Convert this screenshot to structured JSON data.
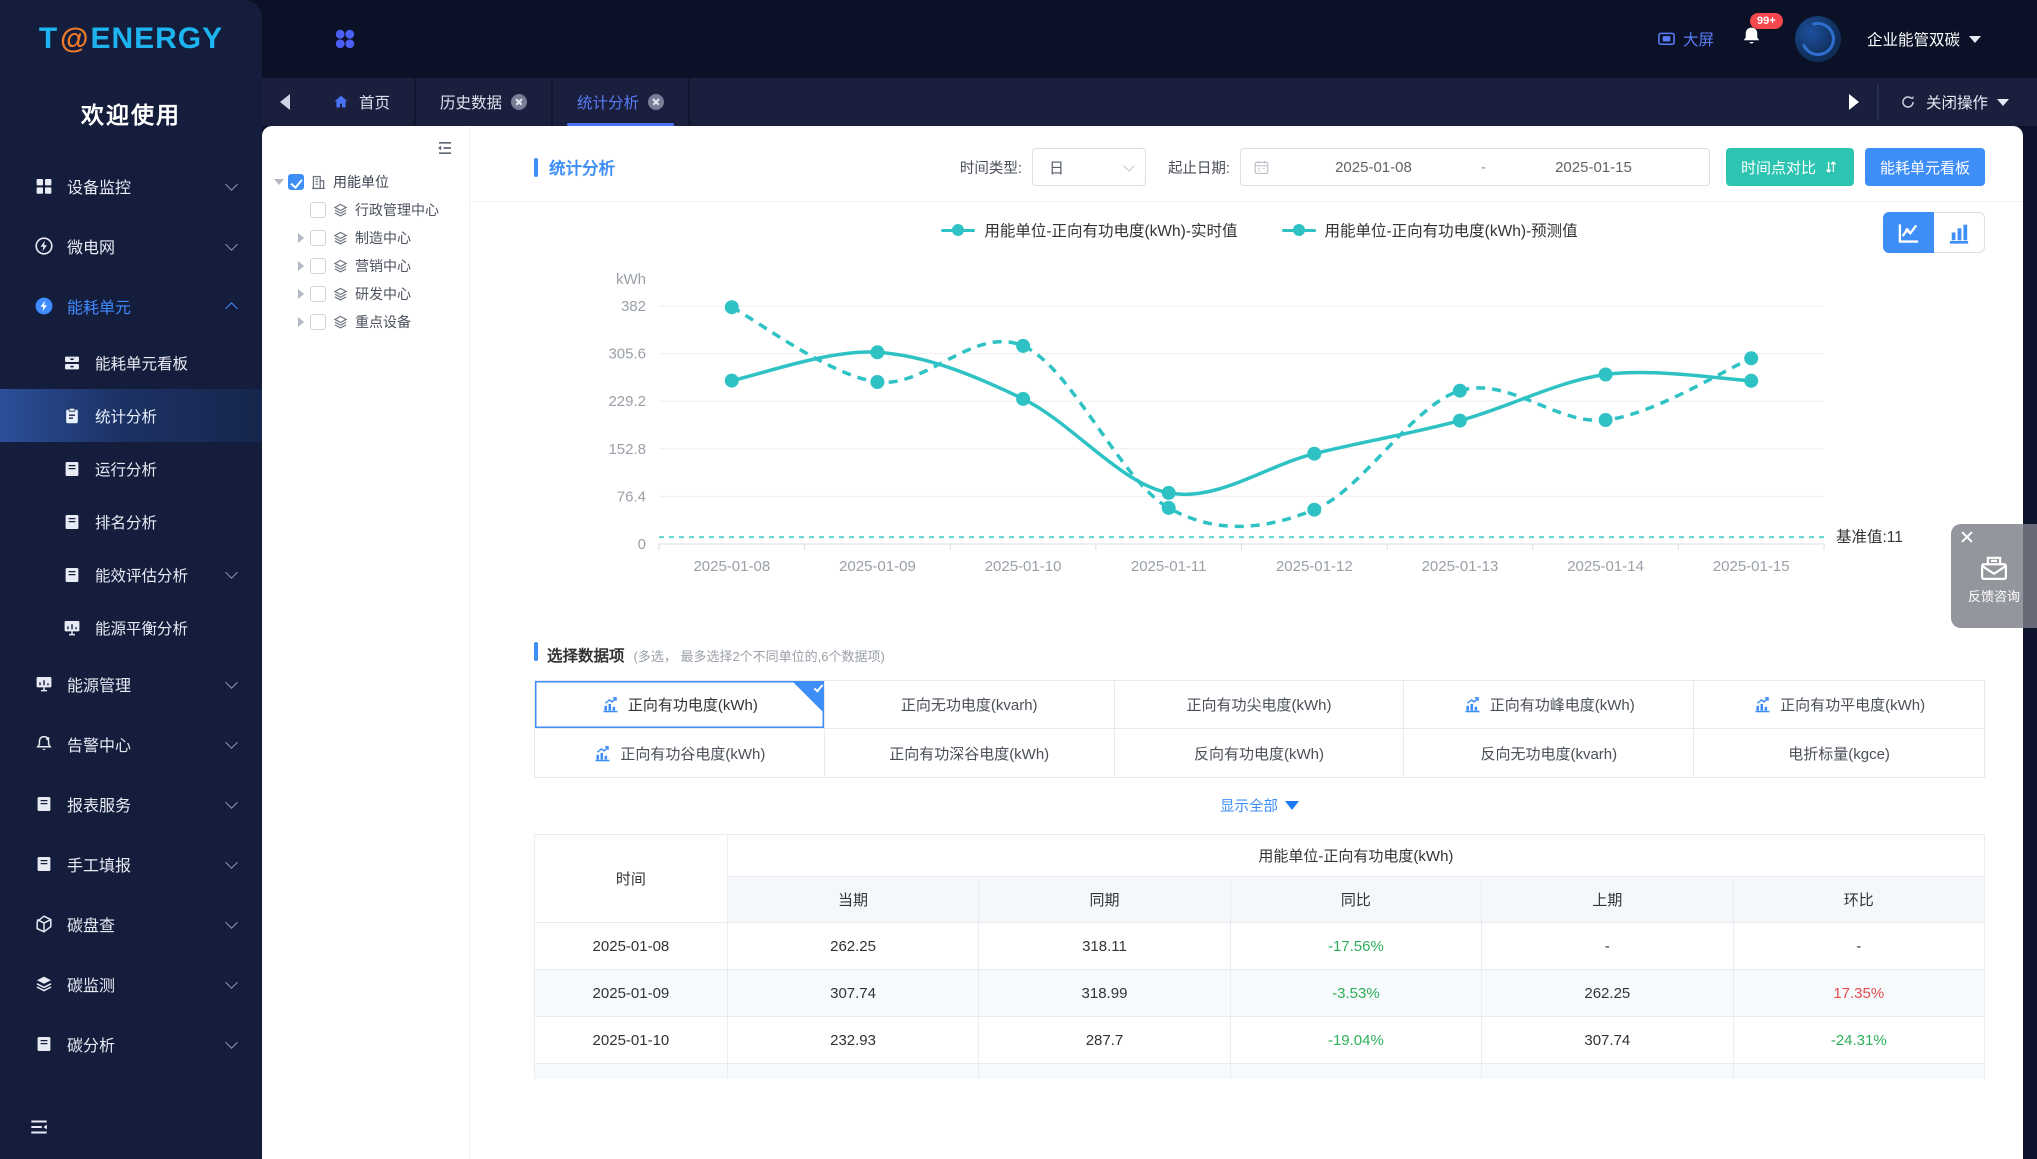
{
  "brand": {
    "logo_t": "T",
    "logo_at": "@",
    "logo_rest": "ENERGY",
    "welcome": "欢迎使用"
  },
  "header": {
    "apps_icon": "apps-grid-icon",
    "big_screen": "大屏",
    "notification_badge": "99+",
    "org_name": "企业能管双碳"
  },
  "tabbar": {
    "home_label": "首页",
    "tabs": [
      {
        "label": "历史数据",
        "active": false
      },
      {
        "label": "统计分析",
        "active": true
      }
    ],
    "close_ops_label": "关闭操作"
  },
  "sidebar": {
    "items": [
      {
        "label": "设备监控",
        "icon": "devices-icon",
        "level": 1,
        "chevron": "down"
      },
      {
        "label": "微电网",
        "icon": "microgrid-icon",
        "level": 1,
        "chevron": "down"
      },
      {
        "label": "能耗单元",
        "icon": "energy-unit-icon",
        "level": 1,
        "chevron": "up",
        "parent_active": true
      },
      {
        "label": "能耗单元看板",
        "icon": "board-icon",
        "level": 2
      },
      {
        "label": "统计分析",
        "icon": "clipboard-icon",
        "level": 2,
        "active": true
      },
      {
        "label": "运行分析",
        "icon": "book-icon",
        "level": 2
      },
      {
        "label": "排名分析",
        "icon": "book-icon",
        "level": 2
      },
      {
        "label": "能效评估分析",
        "icon": "book-icon",
        "level": 2,
        "chevron": "down"
      },
      {
        "label": "能源平衡分析",
        "icon": "monitor-bars-icon",
        "level": 2
      },
      {
        "label": "能源管理",
        "icon": "monitor-bars-icon",
        "level": 1,
        "chevron": "down"
      },
      {
        "label": "告警中心",
        "icon": "alarm-bell-icon",
        "level": 1,
        "chevron": "down"
      },
      {
        "label": "报表服务",
        "icon": "book-icon",
        "level": 1,
        "chevron": "down"
      },
      {
        "label": "手工填报",
        "icon": "book-icon",
        "level": 1,
        "chevron": "down"
      },
      {
        "label": "碳盘查",
        "icon": "cube-icon",
        "level": 1,
        "chevron": "down"
      },
      {
        "label": "碳监测",
        "icon": "layers-icon",
        "level": 1,
        "chevron": "down"
      },
      {
        "label": "碳分析",
        "icon": "book-icon",
        "level": 1,
        "chevron": "down"
      }
    ]
  },
  "tree": {
    "root": {
      "label": "用能单位",
      "checked": true,
      "icon": "building-icon"
    },
    "children": [
      {
        "label": "行政管理中心",
        "caret": false
      },
      {
        "label": "制造中心",
        "caret": true
      },
      {
        "label": "营销中心",
        "caret": true
      },
      {
        "label": "研发中心",
        "caret": true
      },
      {
        "label": "重点设备",
        "caret": true
      }
    ]
  },
  "toolbar": {
    "title": "统计分析",
    "time_type_label": "时间类型:",
    "time_type_value": "日",
    "date_label": "起止日期:",
    "date_start": "2025-01-08",
    "date_separator": "-",
    "date_end": "2025-01-15",
    "compare_button": "时间点对比",
    "board_button": "能耗单元看板"
  },
  "chart_data": {
    "type": "line",
    "title": "",
    "ylabel": "kWh",
    "yticks": [
      0,
      76.4,
      152.8,
      229.2,
      305.6,
      382
    ],
    "ylim": [
      0,
      382
    ],
    "grid": true,
    "legend_position": "top",
    "x": [
      "2025-01-08",
      "2025-01-09",
      "2025-01-10",
      "2025-01-11",
      "2025-01-12",
      "2025-01-13",
      "2025-01-14",
      "2025-01-15"
    ],
    "series": [
      {
        "name": "用能单位-正向有功电度(kWh)-实时值",
        "style": "solid",
        "values": [
          262.25,
          307.74,
          232.93,
          82,
          145,
          198,
          272,
          262
        ]
      },
      {
        "name": "用能单位-正向有功电度(kWh)-预测值",
        "style": "dashed",
        "values": [
          380,
          260,
          318,
          58,
          55,
          246,
          199,
          298
        ]
      }
    ],
    "baseline": {
      "value": 11,
      "label": "基准值:11"
    },
    "line_color": "#2fc2c4"
  },
  "data_items": {
    "title": "选择数据项",
    "hint": "(多选， 最多选择2个不同单位的,6个数据项)",
    "show_all": "显示全部",
    "items": [
      {
        "label": "正向有功电度(kWh)",
        "selected": true,
        "icon": true
      },
      {
        "label": "正向无功电度(kvarh)",
        "selected": false,
        "icon": false
      },
      {
        "label": "正向有功尖电度(kWh)",
        "selected": false,
        "icon": false
      },
      {
        "label": "正向有功峰电度(kWh)",
        "selected": false,
        "icon": true
      },
      {
        "label": "正向有功平电度(kWh)",
        "selected": false,
        "icon": true
      },
      {
        "label": "正向有功谷电度(kWh)",
        "selected": false,
        "icon": true
      },
      {
        "label": "正向有功深谷电度(kWh)",
        "selected": false,
        "icon": false
      },
      {
        "label": "反向有功电度(kWh)",
        "selected": false,
        "icon": false
      },
      {
        "label": "反向无功电度(kvarh)",
        "selected": false,
        "icon": false
      },
      {
        "label": "电折标量(kgce)",
        "selected": false,
        "icon": false
      }
    ]
  },
  "table": {
    "time_header": "时间",
    "group_header": "用能单位-正向有功电度(kWh)",
    "sub_headers": [
      "当期",
      "同期",
      "同比",
      "上期",
      "环比"
    ],
    "rows": [
      {
        "time": "2025-01-08",
        "cells": [
          {
            "v": "262.25",
            "c": ""
          },
          {
            "v": "318.11",
            "c": ""
          },
          {
            "v": "-17.56%",
            "c": "green"
          },
          {
            "v": "-",
            "c": ""
          },
          {
            "v": "-",
            "c": ""
          }
        ]
      },
      {
        "time": "2025-01-09",
        "cells": [
          {
            "v": "307.74",
            "c": ""
          },
          {
            "v": "318.99",
            "c": ""
          },
          {
            "v": "-3.53%",
            "c": "green"
          },
          {
            "v": "262.25",
            "c": ""
          },
          {
            "v": "17.35%",
            "c": "red"
          }
        ]
      },
      {
        "time": "2025-01-10",
        "cells": [
          {
            "v": "232.93",
            "c": ""
          },
          {
            "v": "287.7",
            "c": ""
          },
          {
            "v": "-19.04%",
            "c": "green"
          },
          {
            "v": "307.74",
            "c": ""
          },
          {
            "v": "-24.31%",
            "c": "green"
          }
        ]
      }
    ]
  },
  "feedback": {
    "label": "反馈咨询"
  },
  "colors": {
    "accent_blue": "#3e8ef7",
    "teal_line": "#2fc2c4",
    "teal_button": "#2dc5b2",
    "green": "#2eaf5b",
    "red": "#e34d4d",
    "sidebar_bg": "#141d3c",
    "header_bg": "#0b1126",
    "tab_active": "#5b7cfa",
    "badge_red": "#f5484d"
  }
}
